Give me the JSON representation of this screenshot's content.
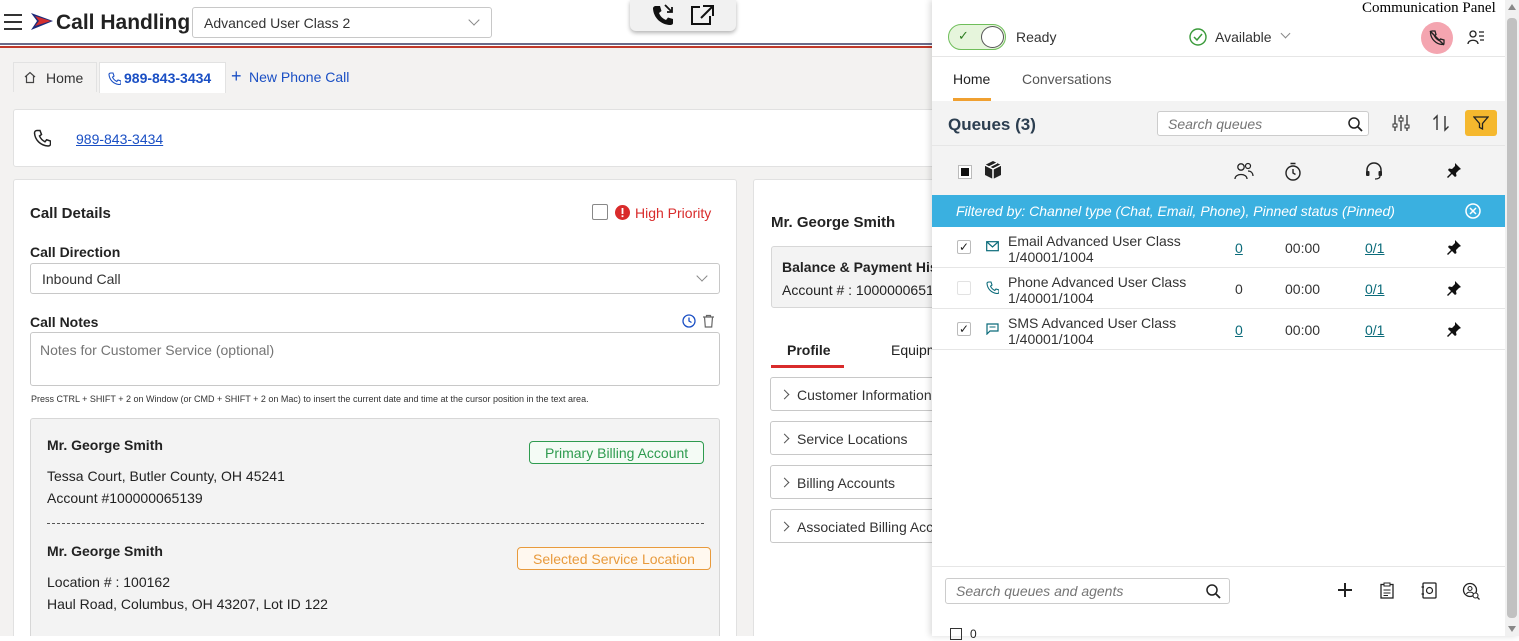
{
  "header": {
    "app_title": "Call Handling",
    "class_select": "Advanced User Class 2"
  },
  "tabs": {
    "home": "Home",
    "phone": "989-843-3434",
    "new_call": "New Phone Call"
  },
  "phone_bar": {
    "number": "989-843-3434"
  },
  "call_details": {
    "title": "Call Details",
    "high_priority": "High Priority",
    "direction_label": "Call Direction",
    "direction_value": "Inbound Call",
    "notes_label": "Call Notes",
    "notes_placeholder": "Notes for Customer Service (optional)",
    "hint": "Press CTRL + SHIFT + 2 on Window (or CMD + SHIFT + 2 on Mac) to insert the current date and time at the cursor position in the text area."
  },
  "accounts": [
    {
      "name": "Mr. George Smith",
      "badge": "Primary Billing Account",
      "line1": "Tessa Court, Butler County, OH 45241",
      "line2": "Account #100000065139"
    },
    {
      "name": "Mr. George Smith",
      "badge": "Selected Service Location",
      "line1": "Location # : 100162",
      "line2": "Haul Road, Columbus, OH 43207, Lot ID 122"
    }
  ],
  "customer": {
    "name": "Mr. George Smith",
    "balance_title": "Balance & Payment Hist",
    "account_line": "Account # : 1000000651",
    "tab_profile": "Profile",
    "tab_equip": "Equipm",
    "sections": [
      "Customer Information",
      "Service Locations",
      "Billing Accounts",
      "Associated Billing Acc"
    ]
  },
  "panel": {
    "title": "Communication Panel",
    "ready": "Ready",
    "available": "Available",
    "tab_home": "Home",
    "tab_conv": "Conversations",
    "queues_title": "Queues (3)",
    "search_placeholder": "Search queues",
    "filter_text": "Filtered by: Channel type (Chat, Email, Phone), Pinned status (Pinned)",
    "bottom_search_placeholder": "Search queues and agents",
    "bottom_count": "0",
    "queues": [
      {
        "line1": "Email Advanced User Class",
        "line2": "1/40001/1004",
        "count": "0",
        "time": "00:00",
        "ratio": "0/1",
        "checked": "✓",
        "count_link": true
      },
      {
        "line1": "Phone Advanced User Class",
        "line2": "1/40001/1004",
        "count": "0",
        "time": "00:00",
        "ratio": "0/1",
        "checked": "",
        "count_link": false
      },
      {
        "line1": "SMS Advanced User Class",
        "line2": "1/40001/1004",
        "count": "0",
        "time": "00:00",
        "ratio": "0/1",
        "checked": "✓",
        "count_link": true
      }
    ]
  },
  "colors": {
    "link": "#1a4fc4",
    "accent_teal": "#3aa6d6",
    "priority_red": "#d92b2b",
    "badge_green": "#2e9b4f",
    "badge_orange": "#e89a3c",
    "tab_underline": "#f0a030"
  }
}
